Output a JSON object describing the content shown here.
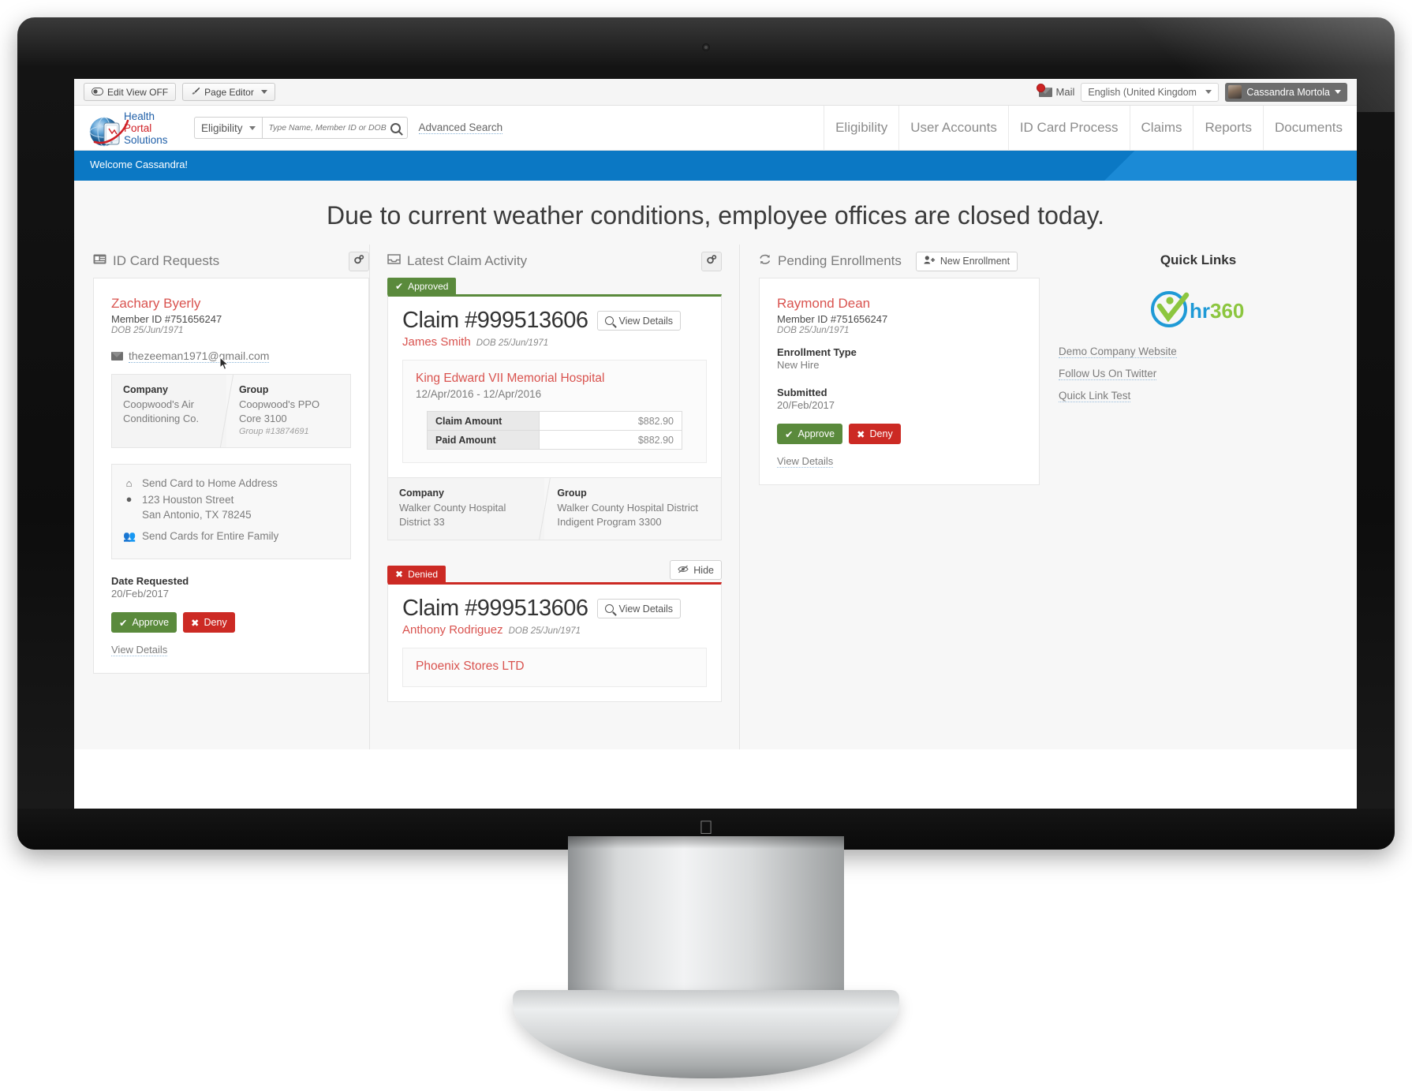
{
  "admin_bar": {
    "edit_view_label": "Edit View OFF",
    "page_editor_label": "Page Editor",
    "mail_label": "Mail",
    "mail_badge": "1",
    "language": "English (United Kingdom",
    "user_name": "Cassandra Mortola"
  },
  "header": {
    "logo_line1": "Health",
    "logo_line2": "Portal",
    "logo_line3": "Solutions",
    "search_scope": "Eligibility",
    "search_placeholder": "Type Name, Member ID or DOB",
    "advanced_search": "Advanced Search",
    "nav": [
      {
        "label": "Eligibility"
      },
      {
        "label": "User Accounts"
      },
      {
        "label": "ID Card Process"
      },
      {
        "label": "Claims"
      },
      {
        "label": "Reports"
      },
      {
        "label": "Documents"
      }
    ]
  },
  "welcome": {
    "text": "Welcome Cassandra!"
  },
  "announcement": {
    "text": "Due to current weather conditions, employee offices are closed today."
  },
  "id_card_requests": {
    "title": "ID Card Requests",
    "settings_icon": "gear-icon",
    "request": {
      "name": "Zachary Byerly",
      "member_id": "Member ID #751656247",
      "dob": "DOB 25/Jun/1971",
      "email": "thezeeman1971@gmail.com",
      "company_label": "Company",
      "company_value": "Coopwood's Air Conditioning Co.",
      "group_label": "Group",
      "group_value": "Coopwood's PPO Core 3100",
      "group_id": "Group #13874691",
      "shipping_option": "Send Card to Home Address",
      "address_line1": "123 Houston Street",
      "address_line2": "San Antonio, TX 78245",
      "family_option": "Send Cards for Entire Family",
      "date_requested_label": "Date Requested",
      "date_requested_value": "20/Feb/2017",
      "approve_label": "Approve",
      "deny_label": "Deny",
      "view_details_label": "View Details"
    }
  },
  "latest_claim_activity": {
    "title": "Latest Claim Activity",
    "settings_icon": "gear-icon",
    "hide_label": "Hide",
    "claims": [
      {
        "status": "Approved",
        "status_type": "approved",
        "claim_number": "Claim #999513606",
        "view_details_label": "View Details",
        "member_name": "James Smith",
        "member_dob": "DOB 25/Jun/1971",
        "provider": "King Edward VII Memorial Hospital",
        "service_dates": "12/Apr/2016 - 12/Apr/2016",
        "claim_amount_label": "Claim Amount",
        "claim_amount_value": "$882.90",
        "paid_amount_label": "Paid Amount",
        "paid_amount_value": "$882.90",
        "company_label": "Company",
        "company_value": "Walker County Hospital District 33",
        "group_label": "Group",
        "group_value": "Walker County Hospital District Indigent Program 3300"
      },
      {
        "status": "Denied",
        "status_type": "denied",
        "claim_number": "Claim #999513606",
        "view_details_label": "View Details",
        "member_name": "Anthony Rodriguez",
        "member_dob": "DOB 25/Jun/1971",
        "provider": "Phoenix Stores LTD"
      }
    ]
  },
  "pending_enrollments": {
    "title": "Pending Enrollments",
    "new_enrollment_label": "New Enrollment",
    "enrollment": {
      "name": "Raymond Dean",
      "member_id": "Member ID #751656247",
      "dob": "DOB 25/Jun/1971",
      "type_label": "Enrollment Type",
      "type_value": "New Hire",
      "submitted_label": "Submitted",
      "submitted_value": "20/Feb/2017",
      "approve_label": "Approve",
      "deny_label": "Deny",
      "view_details_label": "View Details"
    }
  },
  "quick_links": {
    "title": "Quick Links",
    "logo_text": "hr360",
    "links": [
      {
        "label": "Demo Company Website"
      },
      {
        "label": "Follow Us On Twitter"
      },
      {
        "label": "Quick Link Test"
      }
    ]
  },
  "colors": {
    "accent_blue": "#0b78c4",
    "approve_green": "#5a8a3c",
    "deny_red": "#cc2a24",
    "link_red": "#d9534f"
  }
}
